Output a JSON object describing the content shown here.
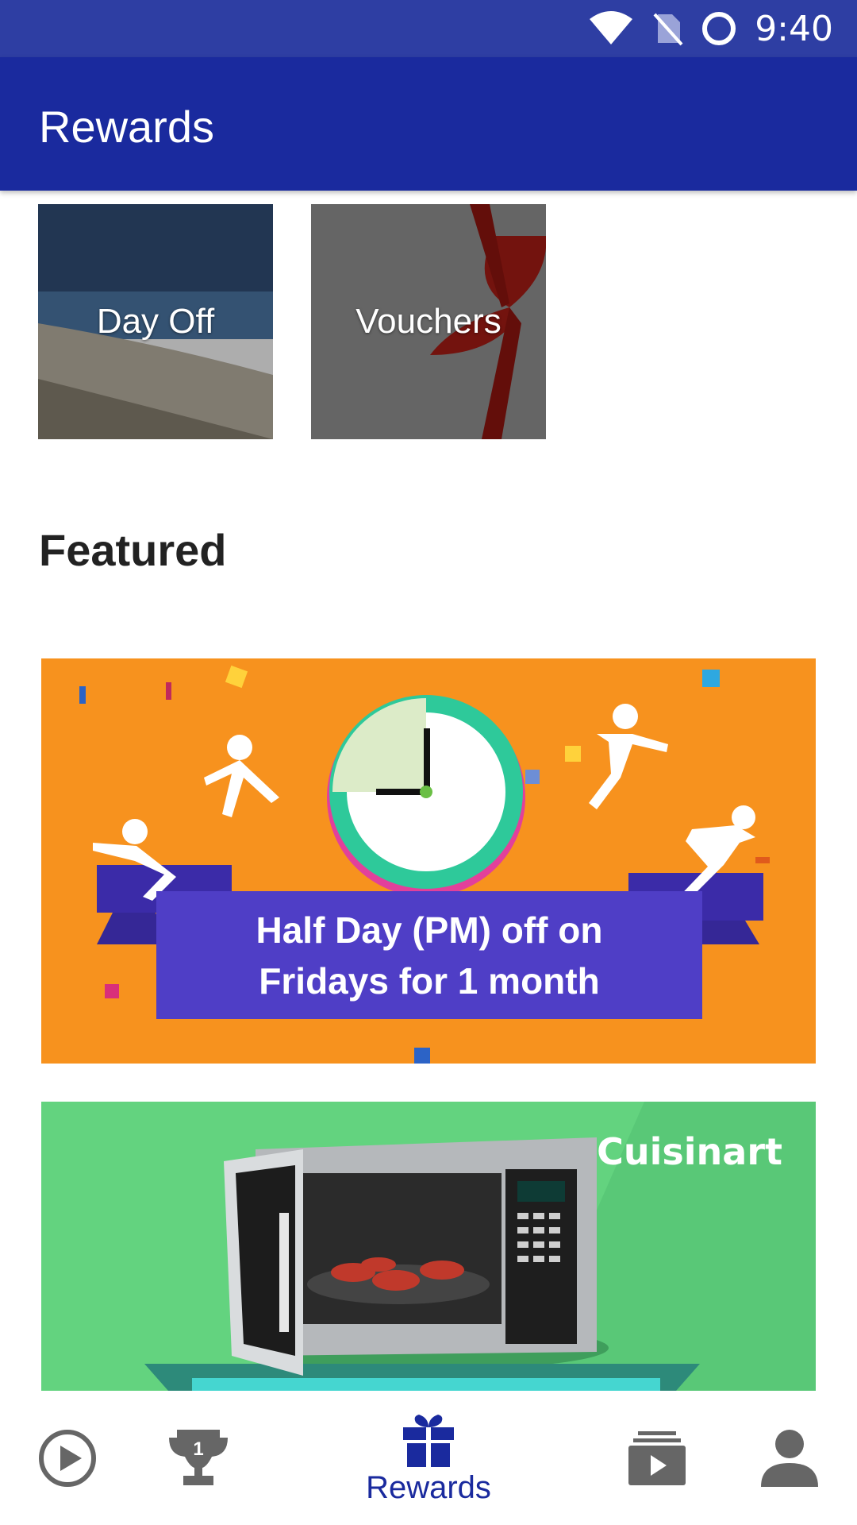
{
  "status_bar": {
    "time": "9:40",
    "icons": [
      "wifi-icon",
      "no-sim-icon",
      "battery-ring-icon"
    ]
  },
  "app_bar": {
    "title": "Rewards"
  },
  "categories": [
    {
      "label": "Day Off",
      "icon": "beach-image"
    },
    {
      "label": "Vouchers",
      "icon": "gift-ribbon-image"
    }
  ],
  "featured": {
    "title": "Featured",
    "banners": [
      {
        "caption_line1": "Half Day (PM) off on",
        "caption_line2": "Fridays for 1 month",
        "bg": "#f7921e"
      },
      {
        "brand": "Cuisinart",
        "bg": "#63d37f"
      }
    ]
  },
  "bottom_nav": {
    "items": [
      {
        "icon": "play-circle-icon",
        "label": ""
      },
      {
        "icon": "trophy-icon",
        "label": ""
      },
      {
        "icon": "gift-icon",
        "label": "Rewards",
        "active": true
      },
      {
        "icon": "video-library-icon",
        "label": ""
      },
      {
        "icon": "person-icon",
        "label": ""
      }
    ]
  },
  "colors": {
    "primary": "#1a2a9e",
    "status_bar": "#2e3ea3",
    "nav_inactive": "#666666"
  }
}
